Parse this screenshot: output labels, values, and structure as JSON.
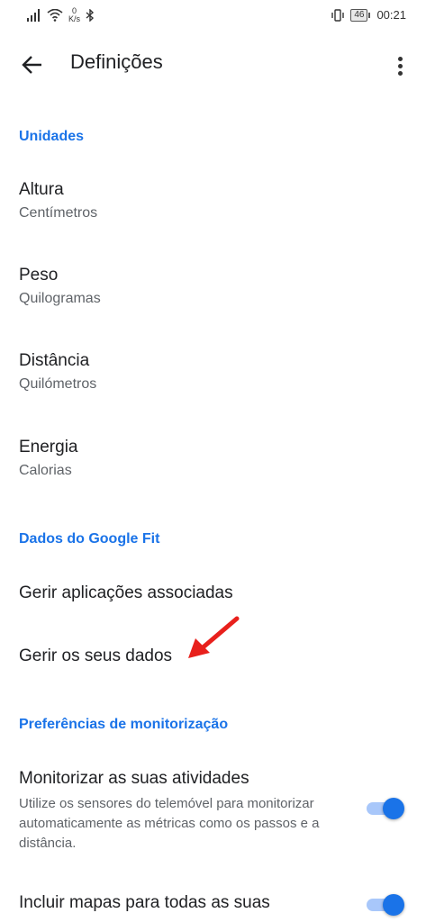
{
  "status_bar": {
    "net_speed_value": "0",
    "net_speed_unit": "K/s",
    "battery_level": "46",
    "time": "00:21"
  },
  "appbar": {
    "title": "Definições"
  },
  "sections": {
    "units": {
      "header": "Unidades",
      "items": [
        {
          "title": "Altura",
          "value": "Centímetros"
        },
        {
          "title": "Peso",
          "value": "Quilogramas"
        },
        {
          "title": "Distância",
          "value": "Quilómetros"
        },
        {
          "title": "Energia",
          "value": "Calorias"
        }
      ]
    },
    "google_fit": {
      "header": "Dados do Google Fit",
      "items": [
        {
          "title": "Gerir aplicações associadas"
        },
        {
          "title": "Gerir os seus dados"
        }
      ]
    },
    "tracking": {
      "header": "Preferências de monitorização",
      "items": [
        {
          "title": "Monitorizar as suas atividades",
          "desc": "Utilize os sensores do telemóvel para monitorizar automaticamente as métricas como os passos e a distância.",
          "enabled": true
        },
        {
          "title": "Incluir mapas para todas as suas",
          "enabled": true
        }
      ]
    }
  },
  "colors": {
    "accent": "#1a73e8",
    "annotation_arrow": "#e8201c"
  }
}
